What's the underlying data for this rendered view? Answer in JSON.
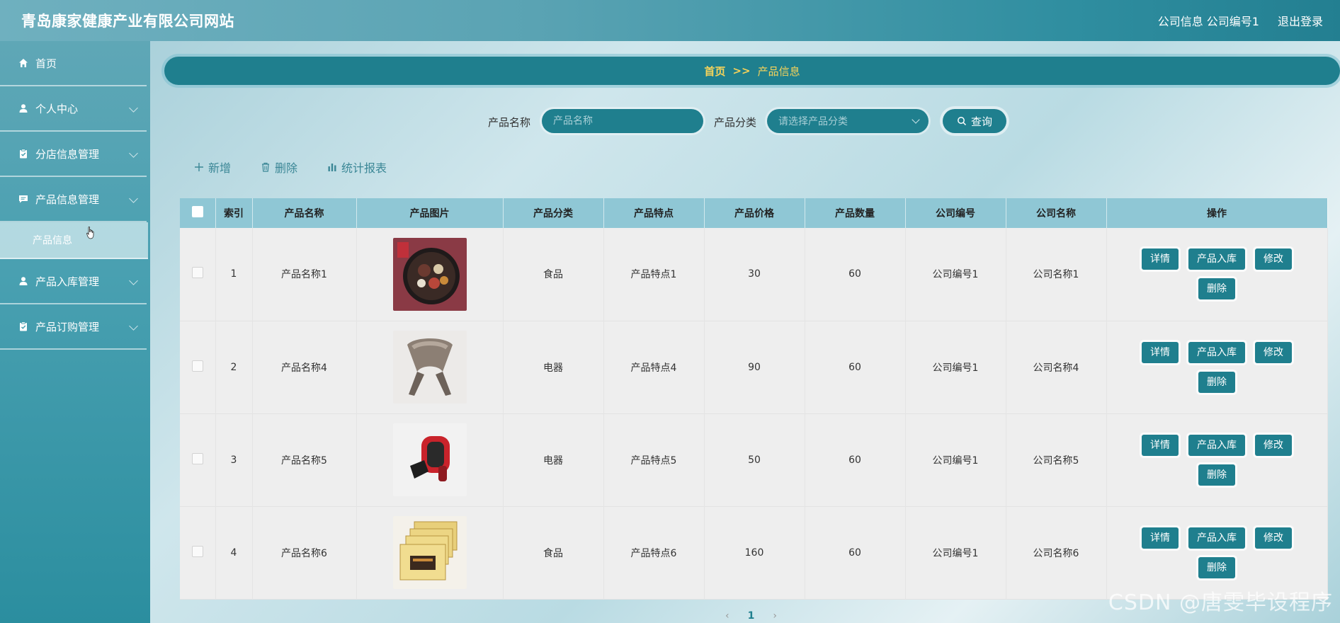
{
  "header": {
    "site_title": "青岛康家健康产业有限公司网站",
    "user_info": "公司信息 公司编号1",
    "logout": "退出登录"
  },
  "sidebar": {
    "items": [
      {
        "label": "首页",
        "icon": "home-icon"
      },
      {
        "label": "个人中心",
        "icon": "user-icon"
      },
      {
        "label": "分店信息管理",
        "icon": "clipboard-icon"
      },
      {
        "label": "产品信息管理",
        "icon": "message-icon"
      },
      {
        "label": "产品入库管理",
        "icon": "user-icon"
      },
      {
        "label": "产品订购管理",
        "icon": "clipboard-icon"
      }
    ],
    "submenu_active": "产品信息"
  },
  "breadcrumb": {
    "home": "首页",
    "sep": ">>",
    "current": "产品信息"
  },
  "search": {
    "name_label": "产品名称",
    "name_placeholder": "产品名称",
    "category_label": "产品分类",
    "category_placeholder": "请选择产品分类",
    "query_button": "查询"
  },
  "toolbar": {
    "add": "新增",
    "delete": "删除",
    "report": "统计报表"
  },
  "table": {
    "headers": [
      "索引",
      "产品名称",
      "产品图片",
      "产品分类",
      "产品特点",
      "产品价格",
      "产品数量",
      "公司编号",
      "公司名称",
      "操作"
    ],
    "rows": [
      {
        "index": "1",
        "name": "产品名称1",
        "image": "food-platter-image",
        "category": "食品",
        "feature": "产品特点1",
        "price": "30",
        "qty": "60",
        "company_no": "公司编号1",
        "company_name": "公司名称1"
      },
      {
        "index": "2",
        "name": "产品名称4",
        "image": "neck-massager-image",
        "category": "电器",
        "feature": "产品特点4",
        "price": "90",
        "qty": "60",
        "company_no": "公司编号1",
        "company_name": "公司名称4"
      },
      {
        "index": "3",
        "name": "产品名称5",
        "image": "massage-device-image",
        "category": "电器",
        "feature": "产品特点5",
        "price": "50",
        "qty": "60",
        "company_no": "公司编号1",
        "company_name": "公司名称5"
      },
      {
        "index": "4",
        "name": "产品名称6",
        "image": "gift-box-image",
        "category": "食品",
        "feature": "产品特点6",
        "price": "160",
        "qty": "60",
        "company_no": "公司编号1",
        "company_name": "公司名称6"
      }
    ],
    "ops": {
      "detail": "详情",
      "stock_in": "产品入库",
      "edit": "修改",
      "delete": "删除"
    }
  },
  "pager": {
    "prev": "‹",
    "page": "1",
    "next": "›"
  },
  "watermark": "CSDN @唐雯毕设程序",
  "colors": {
    "primary": "#1f7f8e",
    "accent_gold": "#f6d35a",
    "header_row": "#8fc7d5"
  }
}
